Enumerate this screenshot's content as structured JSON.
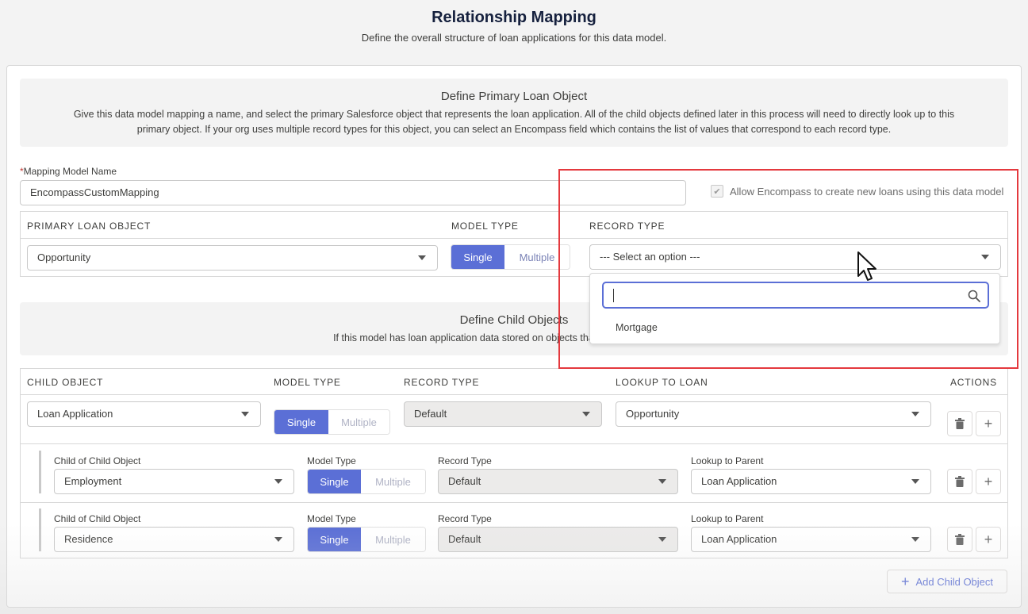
{
  "header": {
    "title": "Relationship Mapping",
    "subtitle": "Define the overall structure of loan applications for this data model."
  },
  "primary_section": {
    "title": "Define Primary Loan Object",
    "description": "Give this data model mapping a name, and select the primary Salesforce object that represents the loan application. All of the child objects defined later in this process will need to directly look up to this primary object. If your org uses multiple record types for this object, you can select an Encompass field which contains the list of values that correspond to each record type."
  },
  "mapping_name": {
    "required_mark": "*",
    "label": "Mapping Model Name",
    "value": "EncompassCustomMapping"
  },
  "allow_create": {
    "checked": true,
    "label": "Allow Encompass to create new loans using this data model"
  },
  "primary_table": {
    "headers": [
      "PRIMARY LOAN OBJECT",
      "MODEL TYPE",
      "RECORD TYPE"
    ],
    "object_value": "Opportunity",
    "model_single": "Single",
    "model_multiple": "Multiple",
    "record_type_placeholder": "--- Select an option ---"
  },
  "record_type_dropdown": {
    "search_value": "",
    "options": [
      "Mortgage"
    ]
  },
  "child_section": {
    "title": "Define Child Objects",
    "description": "If this model has loan application data stored on objects that look up to the primary"
  },
  "child_table": {
    "headers": [
      "CHILD OBJECT",
      "MODEL TYPE",
      "RECORD TYPE",
      "LOOKUP TO LOAN",
      "ACTIONS"
    ],
    "row": {
      "object": "Loan Application",
      "single": "Single",
      "multiple": "Multiple",
      "record_type": "Default",
      "lookup": "Opportunity"
    },
    "sub_labels": {
      "object": "Child of Child Object",
      "model_type": "Model Type",
      "record_type": "Record Type",
      "lookup": "Lookup to Parent"
    },
    "sub_rows": [
      {
        "object": "Employment",
        "single": "Single",
        "multiple": "Multiple",
        "record_type": "Default",
        "lookup": "Loan Application"
      },
      {
        "object": "Residence",
        "single": "Single",
        "multiple": "Multiple",
        "record_type": "Default",
        "lookup": "Loan Application"
      }
    ]
  },
  "add_child_label": "Add Child Object",
  "colors": {
    "brand": "#5b6fd6",
    "highlight": "#e4393e",
    "title": "#16213e"
  },
  "icons": [
    "search-icon",
    "chevron-down-icon",
    "trash-icon",
    "plus-icon",
    "checkmark-icon",
    "mouse-pointer-icon"
  ]
}
